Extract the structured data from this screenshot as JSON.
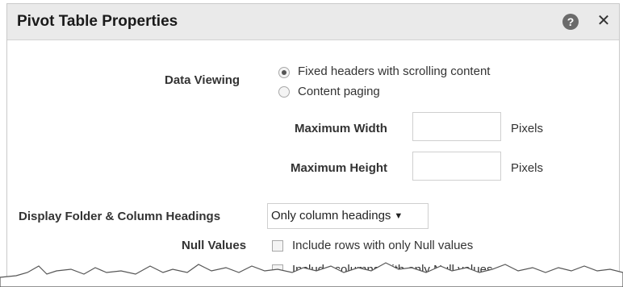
{
  "dialog": {
    "title": "Pivot Table Properties",
    "help_icon": "help-icon",
    "help_glyph": "?",
    "close_icon": "close-icon",
    "close_glyph": "✕"
  },
  "data_viewing": {
    "label": "Data Viewing",
    "options": [
      {
        "label": "Fixed headers with scrolling content",
        "selected": true
      },
      {
        "label": "Content paging",
        "selected": false
      }
    ],
    "max_width": {
      "label": "Maximum Width",
      "value": "",
      "unit": "Pixels"
    },
    "max_height": {
      "label": "Maximum Height",
      "value": "",
      "unit": "Pixels"
    }
  },
  "display_headings": {
    "label": "Display Folder & Column Headings",
    "selected": "Only column headings",
    "caret_glyph": "▼"
  },
  "null_values": {
    "label": "Null Values",
    "options": [
      {
        "label": "Include rows with only Null values",
        "checked": false
      },
      {
        "label": "Include columns with only Null values",
        "checked": false
      }
    ]
  },
  "colors": {
    "titlebar_bg": "#eaeaea",
    "border": "#c9c9c9",
    "label_text": "#333333"
  }
}
